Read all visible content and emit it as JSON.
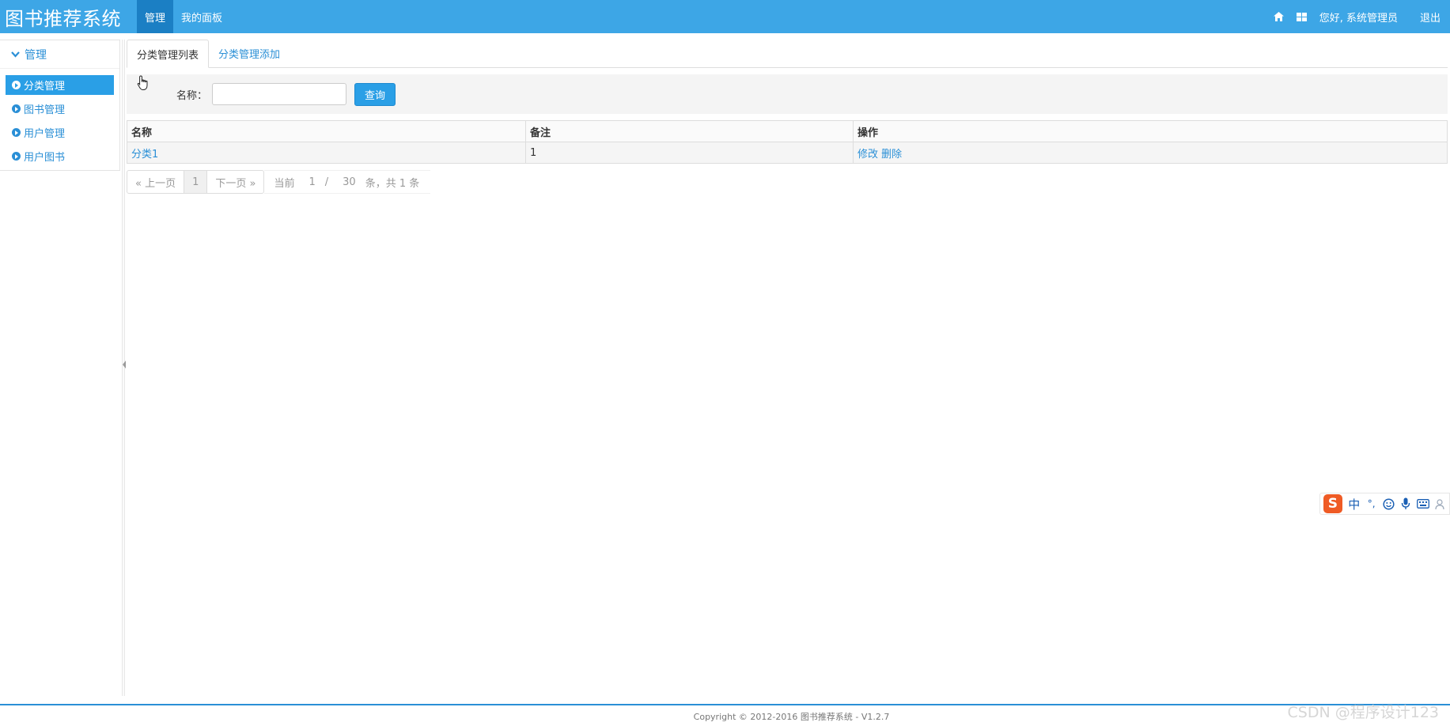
{
  "header": {
    "brand": "图书推荐系统",
    "nav": [
      {
        "label": "管理",
        "active": true
      },
      {
        "label": "我的面板",
        "active": false
      }
    ],
    "greeting": "您好, 系统管理员",
    "logout": "退出",
    "icons": [
      "home-icon",
      "grid-icon"
    ]
  },
  "sidebar": {
    "section_title": "管理",
    "items": [
      {
        "label": "分类管理",
        "active": true
      },
      {
        "label": "图书管理",
        "active": false
      },
      {
        "label": "用户管理",
        "active": false
      },
      {
        "label": "用户图书",
        "active": false
      }
    ]
  },
  "main": {
    "tabs": [
      {
        "label": "分类管理列表",
        "active": true
      },
      {
        "label": "分类管理添加",
        "active": false
      }
    ],
    "search": {
      "label": "名称：",
      "value": "",
      "button": "查询"
    },
    "table": {
      "columns": [
        "名称",
        "备注",
        "操作"
      ],
      "rows": [
        {
          "name": "分类1",
          "remark": "1",
          "edit": "修改",
          "delete": "删除"
        }
      ]
    },
    "pager": {
      "prev": "« 上一页",
      "page": "1",
      "next": "下一页 »",
      "current_label": "当前",
      "current_page": "1",
      "separator": "/",
      "page_size": "30",
      "total_text": "条，共 1 条"
    }
  },
  "footer": {
    "copyright": "Copyright © 2012-2016 图书推荐系统 - V1.2.7"
  },
  "watermark": "CSDN @程序设计123",
  "ime": {
    "logo": "S",
    "mode": "中",
    "punct": "°,",
    "icons": [
      "emoji-icon",
      "microphone-icon",
      "keyboard-icon",
      "skin-icon"
    ]
  },
  "colors": {
    "header_bg": "#3da6e6",
    "nav_active_bg": "#1b7fc4",
    "accent": "#2a9fe6",
    "link": "#2a8fd6"
  }
}
